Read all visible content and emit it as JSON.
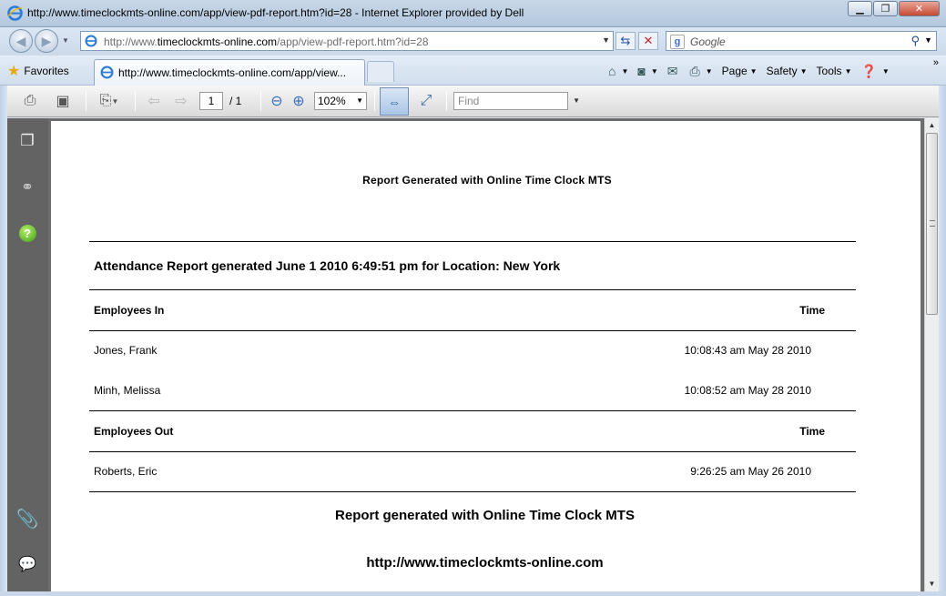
{
  "window": {
    "title": "http://www.timeclockmts-online.com/app/view-pdf-report.htm?id=28 - Internet Explorer provided by Dell",
    "minimize": "▁",
    "maximize": "❐",
    "close": "✕"
  },
  "address_bar": {
    "url_prefix": "http://www.",
    "url_domain": "timeclockmts-online.com",
    "url_path": "/app/view-pdf-report.htm?id=28"
  },
  "search": {
    "provider": "Google"
  },
  "favorites": {
    "label": "Favorites"
  },
  "tab": {
    "title": "http://www.timeclockmts-online.com/app/view..."
  },
  "command_bar": {
    "page": "Page",
    "safety": "Safety",
    "tools": "Tools"
  },
  "pdf_toolbar": {
    "current_page": "1",
    "page_total": "/ 1",
    "zoom": "102%",
    "find_placeholder": "Find"
  },
  "report": {
    "header": "Report Generated with Online Time Clock MTS",
    "title": "Attendance Report generated June 1 2010 6:49:51 pm for Location: New York",
    "in_section": {
      "label": "Employees In",
      "time_label": "Time",
      "rows": [
        {
          "name": "Jones, Frank",
          "time": "10:08:43 am May 28 2010"
        },
        {
          "name": "Minh, Melissa",
          "time": "10:08:52 am May 28 2010"
        }
      ]
    },
    "out_section": {
      "label": "Employees Out",
      "time_label": "Time",
      "rows": [
        {
          "name": "Roberts, Eric",
          "time": "9:26:25 am May 26 2010"
        }
      ]
    },
    "footer_line1": "Report generated with Online Time Clock MTS",
    "footer_line2": "http://www.timeclockmts-online.com"
  },
  "colors": {
    "sidebar": "#636363",
    "doc_background": "#6d6d6d",
    "page": "#ffffff"
  }
}
